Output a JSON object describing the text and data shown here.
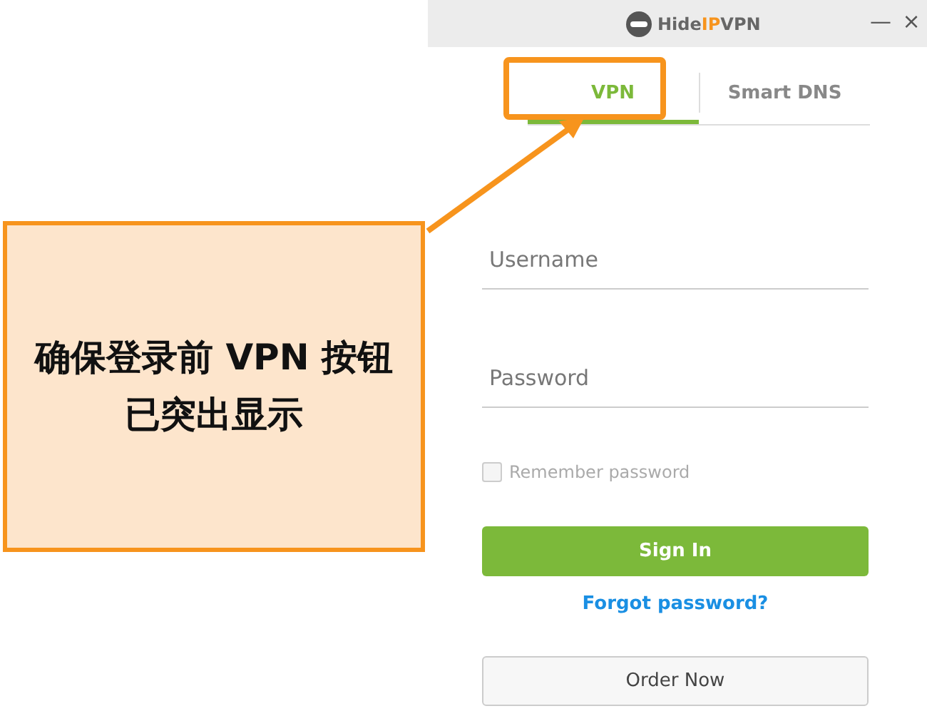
{
  "window": {
    "logo": {
      "parts": [
        {
          "text": "Hide",
          "accent": false
        },
        {
          "text": "IP",
          "accent": true
        },
        {
          "text": "VPN",
          "accent": false
        }
      ]
    },
    "controls": [
      "—",
      "×"
    ]
  },
  "tabs": [
    {
      "label": "VPN",
      "selected": true
    },
    {
      "label": "Smart DNS",
      "selected": false
    }
  ],
  "form": {
    "username": {
      "placeholder": "Username"
    },
    "password": {
      "placeholder": "Password"
    },
    "remember": {
      "label": "Remember password",
      "checked": false
    },
    "sign_in": "Sign In",
    "forgot": "Forgot password?",
    "order": "Order Now"
  },
  "callout": {
    "text": "确保登录前 VPN 按钮已突出显示"
  }
}
